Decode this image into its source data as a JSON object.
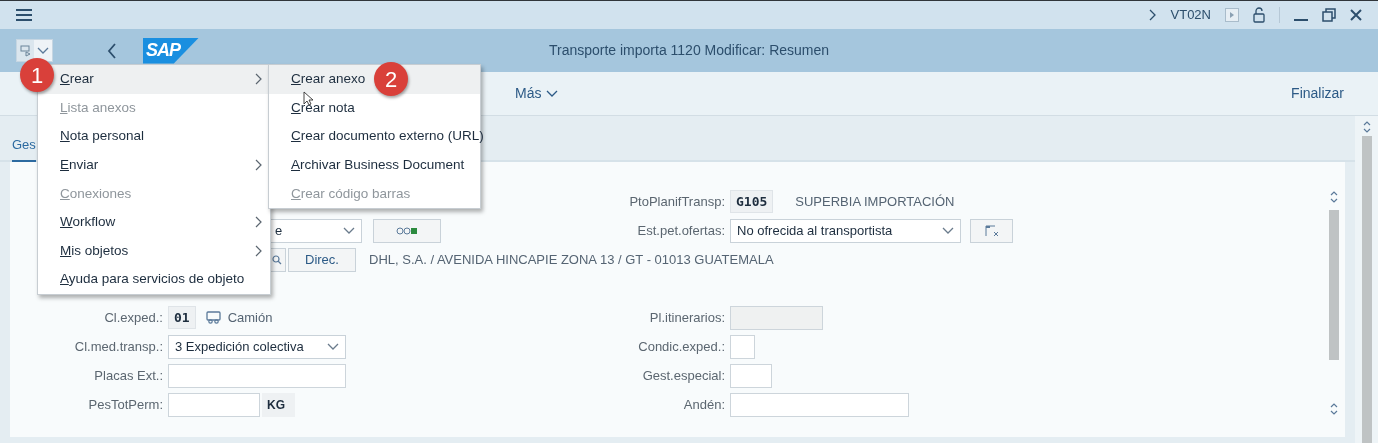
{
  "top_bar": {
    "transaction": "VT02N"
  },
  "logo": "SAP",
  "title": "Transporte importa 1120 Modificar: Resumen",
  "toolbar": {
    "more": "Más",
    "finish": "Finalizar"
  },
  "tabs": [
    {
      "label": "Ges",
      "selected": true
    }
  ],
  "form": {
    "upper_rows": [
      {
        "right": {
          "label": "PtoPlanifTransp:",
          "kind": "code",
          "value": "G105",
          "description": "SUPERBIA IMPORTACIÓN"
        }
      },
      {
        "left": {
          "kind": "dropdown",
          "value": "e"
        },
        "right": {
          "label": "Est.pet.ofertas:",
          "kind": "dropdown",
          "value": "No ofrecida al transportista"
        }
      },
      {
        "left": {
          "kind": "address",
          "button": "Direc.",
          "text": "DHL, S.A. / AVENIDA HINCAPIE ZONA 13 / GT - 01013 GUATEMALA"
        }
      }
    ],
    "lower_rows": [
      {
        "left": {
          "label": "Cl.exped.:",
          "kind": "code",
          "value": "01",
          "description": "Camión"
        },
        "right": {
          "label": "Pl.itinerarios:",
          "kind": "text",
          "disabled": true
        }
      },
      {
        "left": {
          "label": "Cl.med.transp.:",
          "kind": "dropdown",
          "value": "3 Expedición colectiva"
        },
        "right": {
          "label": "Condic.exped.:",
          "kind": "text",
          "disabled": false
        }
      },
      {
        "left": {
          "label": "Placas Ext.:",
          "kind": "text",
          "disabled": false
        },
        "right": {
          "label": "Gest.especial:",
          "kind": "text",
          "disabled": false
        }
      },
      {
        "left": {
          "label": "PesTotPerm:",
          "kind": "text",
          "disabled": false,
          "unit": "KG"
        },
        "right": {
          "label": "Andén:",
          "kind": "text",
          "disabled": false
        }
      }
    ]
  },
  "menu": {
    "badge": "1",
    "items": [
      {
        "label": "Crear",
        "selected": true,
        "disabled": false,
        "submenu": true
      },
      {
        "label": "Lista anexos",
        "selected": false,
        "disabled": true,
        "submenu": false
      },
      {
        "label": "Nota personal",
        "selected": false,
        "disabled": false,
        "submenu": false
      },
      {
        "label": "Enviar",
        "selected": false,
        "disabled": false,
        "submenu": true
      },
      {
        "label": "Conexiones",
        "selected": false,
        "disabled": true,
        "submenu": false
      },
      {
        "label": "Workflow",
        "selected": false,
        "disabled": false,
        "submenu": true
      },
      {
        "label": "Mis objetos",
        "selected": false,
        "disabled": false,
        "submenu": true
      },
      {
        "label": "Ayuda para servicios de objeto",
        "selected": false,
        "disabled": false,
        "submenu": false
      }
    ]
  },
  "submenu": {
    "badge": "2",
    "items": [
      {
        "label": "Crear anexo",
        "selected": true,
        "disabled": false
      },
      {
        "label": "Crear nota",
        "selected": false,
        "disabled": false
      },
      {
        "label": "Crear documento externo (URL)",
        "selected": false,
        "disabled": false
      },
      {
        "label": "Archivar Business Document",
        "selected": false,
        "disabled": false
      },
      {
        "label": "Crear código barras",
        "selected": false,
        "disabled": true
      }
    ]
  }
}
